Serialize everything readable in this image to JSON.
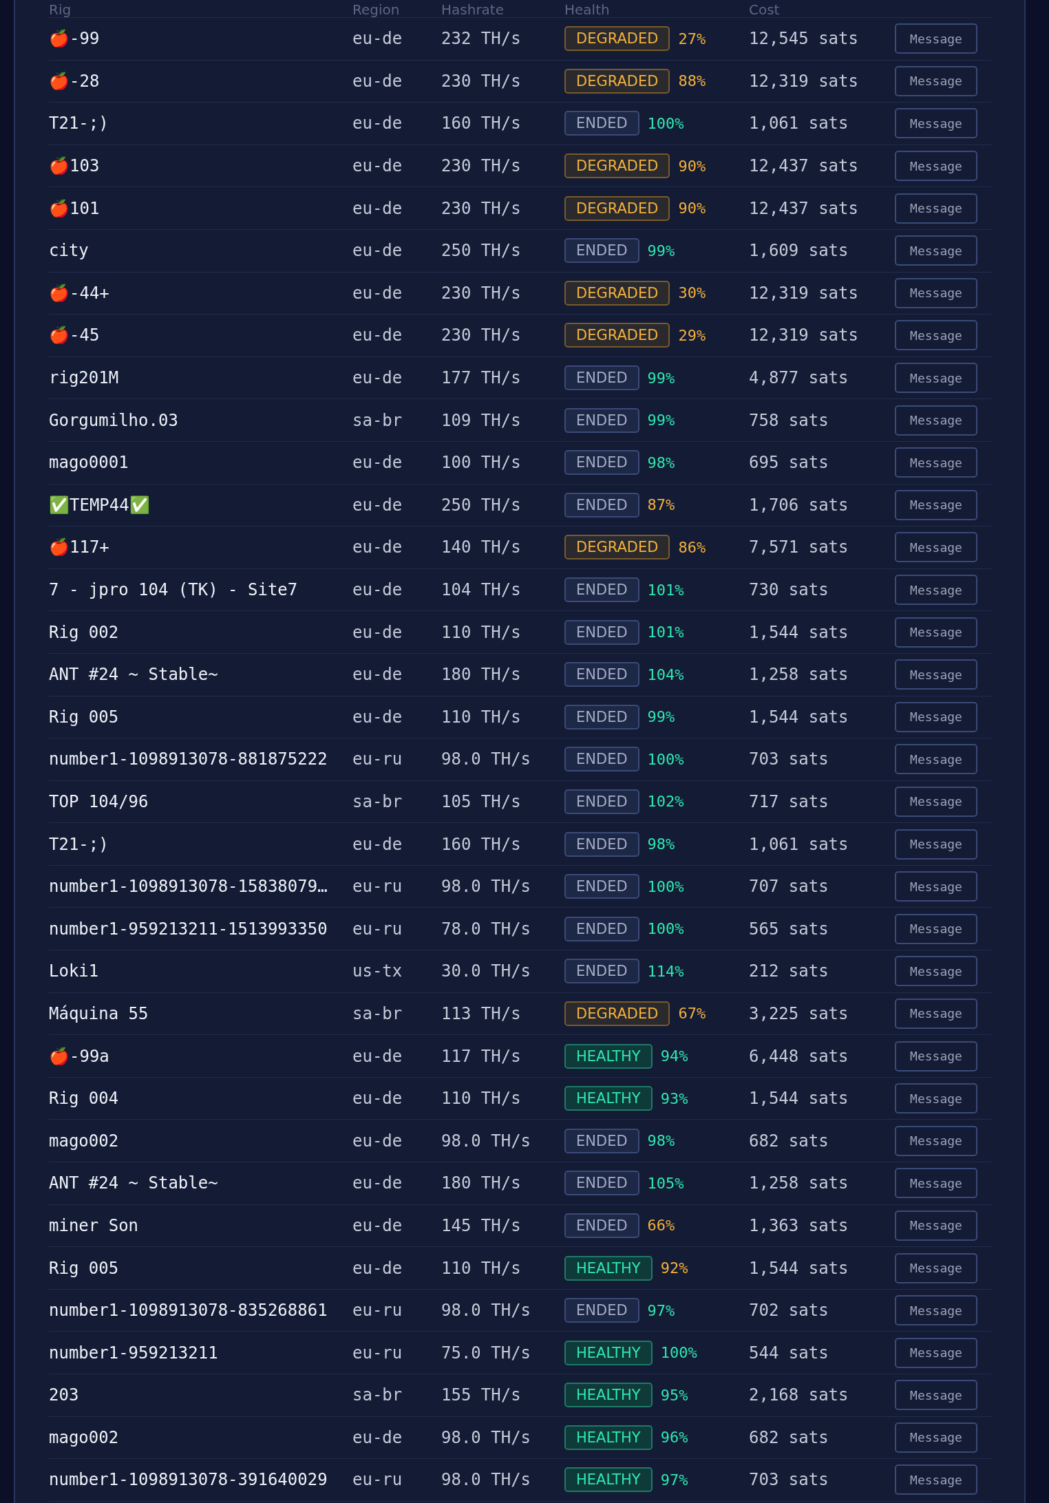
{
  "table": {
    "columns": [
      "Rig",
      "Region",
      "Hashrate",
      "Health",
      "Cost"
    ],
    "rows": [
      {
        "rig": "🍎-99",
        "region": "eu-de",
        "hashrate": "232 TH/s",
        "kind": "degraded",
        "status": "DEGRADED",
        "health": "27%",
        "warning": true,
        "cost": "12,545 sats",
        "action": "Message"
      },
      {
        "rig": "🍎-28",
        "region": "eu-de",
        "hashrate": "230 TH/s",
        "kind": "degraded",
        "status": "DEGRADED",
        "health": "88%",
        "warning": true,
        "cost": "12,319 sats",
        "action": "Message"
      },
      {
        "rig": "T21-;)",
        "region": "eu-de",
        "hashrate": "160 TH/s",
        "kind": "ended",
        "status": "ENDED",
        "health": "100%",
        "warning": false,
        "cost": "1,061 sats",
        "action": "Message"
      },
      {
        "rig": "🍎103",
        "region": "eu-de",
        "hashrate": "230 TH/s",
        "kind": "degraded",
        "status": "DEGRADED",
        "health": "90%",
        "warning": true,
        "cost": "12,437 sats",
        "action": "Message"
      },
      {
        "rig": "🍎101",
        "region": "eu-de",
        "hashrate": "230 TH/s",
        "kind": "degraded",
        "status": "DEGRADED",
        "health": "90%",
        "warning": true,
        "cost": "12,437 sats",
        "action": "Message"
      },
      {
        "rig": "city",
        "region": "eu-de",
        "hashrate": "250 TH/s",
        "kind": "ended",
        "status": "ENDED",
        "health": "99%",
        "warning": false,
        "cost": "1,609 sats",
        "action": "Message"
      },
      {
        "rig": "🍎-44+",
        "region": "eu-de",
        "hashrate": "230 TH/s",
        "kind": "degraded",
        "status": "DEGRADED",
        "health": "30%",
        "warning": true,
        "cost": "12,319 sats",
        "action": "Message"
      },
      {
        "rig": "🍎-45",
        "region": "eu-de",
        "hashrate": "230 TH/s",
        "kind": "degraded",
        "status": "DEGRADED",
        "health": "29%",
        "warning": true,
        "cost": "12,319 sats",
        "action": "Message"
      },
      {
        "rig": "rig201M",
        "region": "eu-de",
        "hashrate": "177 TH/s",
        "kind": "ended",
        "status": "ENDED",
        "health": "99%",
        "warning": false,
        "cost": "4,877 sats",
        "action": "Message"
      },
      {
        "rig": "Gorgumilho.03",
        "region": "sa-br",
        "hashrate": "109 TH/s",
        "kind": "ended",
        "status": "ENDED",
        "health": "99%",
        "warning": false,
        "cost": "758 sats",
        "action": "Message"
      },
      {
        "rig": "mago0001",
        "region": "eu-de",
        "hashrate": "100 TH/s",
        "kind": "ended",
        "status": "ENDED",
        "health": "98%",
        "warning": false,
        "cost": "695 sats",
        "action": "Message"
      },
      {
        "rig": "✅TEMP44✅",
        "region": "eu-de",
        "hashrate": "250 TH/s",
        "kind": "ended",
        "status": "ENDED",
        "health": "87%",
        "warning": true,
        "cost": "1,706 sats",
        "action": "Message"
      },
      {
        "rig": "🍎117+",
        "region": "eu-de",
        "hashrate": "140 TH/s",
        "kind": "degraded",
        "status": "DEGRADED",
        "health": "86%",
        "warning": true,
        "cost": "7,571 sats",
        "action": "Message"
      },
      {
        "rig": "7 - jpro 104 (TK) - Site7",
        "region": "eu-de",
        "hashrate": "104 TH/s",
        "kind": "ended",
        "status": "ENDED",
        "health": "101%",
        "warning": false,
        "cost": "730 sats",
        "action": "Message"
      },
      {
        "rig": "Rig 002",
        "region": "eu-de",
        "hashrate": "110 TH/s",
        "kind": "ended",
        "status": "ENDED",
        "health": "101%",
        "warning": false,
        "cost": "1,544 sats",
        "action": "Message"
      },
      {
        "rig": "ANT #24 ~ Stable~",
        "region": "eu-de",
        "hashrate": "180 TH/s",
        "kind": "ended",
        "status": "ENDED",
        "health": "104%",
        "warning": false,
        "cost": "1,258 sats",
        "action": "Message"
      },
      {
        "rig": "Rig 005",
        "region": "eu-de",
        "hashrate": "110 TH/s",
        "kind": "ended",
        "status": "ENDED",
        "health": "99%",
        "warning": false,
        "cost": "1,544 sats",
        "action": "Message"
      },
      {
        "rig": "number1-1098913078-881875222",
        "region": "eu-ru",
        "hashrate": "98.0 TH/s",
        "kind": "ended",
        "status": "ENDED",
        "health": "100%",
        "warning": false,
        "cost": "703 sats",
        "action": "Message"
      },
      {
        "rig": "TOP 104/96",
        "region": "sa-br",
        "hashrate": "105 TH/s",
        "kind": "ended",
        "status": "ENDED",
        "health": "102%",
        "warning": false,
        "cost": "717 sats",
        "action": "Message"
      },
      {
        "rig": "T21-;)",
        "region": "eu-de",
        "hashrate": "160 TH/s",
        "kind": "ended",
        "status": "ENDED",
        "health": "98%",
        "warning": false,
        "cost": "1,061 sats",
        "action": "Message"
      },
      {
        "rig": "number1-1098913078-15838079…",
        "region": "eu-ru",
        "hashrate": "98.0 TH/s",
        "kind": "ended",
        "status": "ENDED",
        "health": "100%",
        "warning": false,
        "cost": "707 sats",
        "action": "Message"
      },
      {
        "rig": "number1-959213211-1513993350",
        "region": "eu-ru",
        "hashrate": "78.0 TH/s",
        "kind": "ended",
        "status": "ENDED",
        "health": "100%",
        "warning": false,
        "cost": "565 sats",
        "action": "Message"
      },
      {
        "rig": "Loki1",
        "region": "us-tx",
        "hashrate": "30.0 TH/s",
        "kind": "ended",
        "status": "ENDED",
        "health": "114%",
        "warning": false,
        "cost": "212 sats",
        "action": "Message"
      },
      {
        "rig": "Máquina 55",
        "region": "sa-br",
        "hashrate": "113 TH/s",
        "kind": "degraded",
        "status": "DEGRADED",
        "health": "67%",
        "warning": true,
        "cost": "3,225 sats",
        "action": "Message"
      },
      {
        "rig": "🍎-99a",
        "region": "eu-de",
        "hashrate": "117 TH/s",
        "kind": "healthy",
        "status": "HEALTHY",
        "health": "94%",
        "warning": false,
        "cost": "6,448 sats",
        "action": "Message"
      },
      {
        "rig": "Rig 004",
        "region": "eu-de",
        "hashrate": "110 TH/s",
        "kind": "healthy",
        "status": "HEALTHY",
        "health": "93%",
        "warning": false,
        "cost": "1,544 sats",
        "action": "Message"
      },
      {
        "rig": "mago002",
        "region": "eu-de",
        "hashrate": "98.0 TH/s",
        "kind": "ended",
        "status": "ENDED",
        "health": "98%",
        "warning": false,
        "cost": "682 sats",
        "action": "Message"
      },
      {
        "rig": "ANT #24 ~ Stable~",
        "region": "eu-de",
        "hashrate": "180 TH/s",
        "kind": "ended",
        "status": "ENDED",
        "health": "105%",
        "warning": false,
        "cost": "1,258 sats",
        "action": "Message"
      },
      {
        "rig": "miner Son",
        "region": "eu-de",
        "hashrate": "145 TH/s",
        "kind": "ended",
        "status": "ENDED",
        "health": "66%",
        "warning": true,
        "cost": "1,363 sats",
        "action": "Message"
      },
      {
        "rig": "Rig 005",
        "region": "eu-de",
        "hashrate": "110 TH/s",
        "kind": "healthy",
        "status": "HEALTHY",
        "health": "92%",
        "warning": true,
        "cost": "1,544 sats",
        "action": "Message"
      },
      {
        "rig": "number1-1098913078-835268861",
        "region": "eu-ru",
        "hashrate": "98.0 TH/s",
        "kind": "ended",
        "status": "ENDED",
        "health": "97%",
        "warning": false,
        "cost": "702 sats",
        "action": "Message"
      },
      {
        "rig": "number1-959213211",
        "region": "eu-ru",
        "hashrate": "75.0 TH/s",
        "kind": "healthy",
        "status": "HEALTHY",
        "health": "100%",
        "warning": false,
        "cost": "544 sats",
        "action": "Message"
      },
      {
        "rig": "203",
        "region": "sa-br",
        "hashrate": "155 TH/s",
        "kind": "healthy",
        "status": "HEALTHY",
        "health": "95%",
        "warning": false,
        "cost": "2,168 sats",
        "action": "Message"
      },
      {
        "rig": "mago002",
        "region": "eu-de",
        "hashrate": "98.0 TH/s",
        "kind": "healthy",
        "status": "HEALTHY",
        "health": "96%",
        "warning": false,
        "cost": "682 sats",
        "action": "Message"
      },
      {
        "rig": "number1-1098913078-391640029",
        "region": "eu-ru",
        "hashrate": "98.0 TH/s",
        "kind": "healthy",
        "status": "HEALTHY",
        "health": "97%",
        "warning": false,
        "cost": "703 sats",
        "action": "Message"
      }
    ]
  }
}
